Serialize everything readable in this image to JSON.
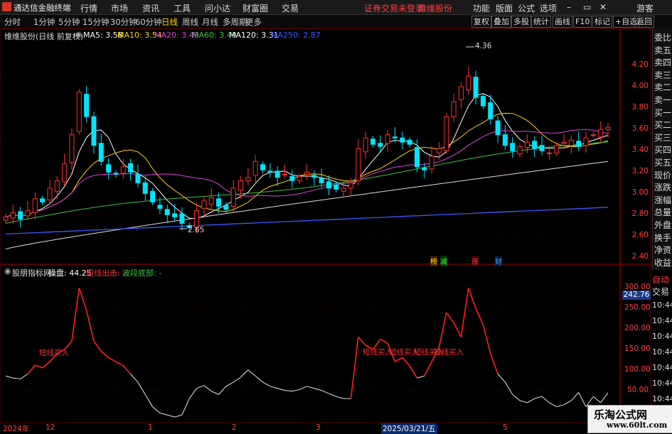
{
  "menubar": {
    "app_title": "通达信金融终端",
    "menu": [
      "行情",
      "市场",
      "资讯",
      "工具",
      "问小达",
      "财富圈",
      "交易"
    ],
    "notice": "证券交易未登录",
    "stock_name": "维维股份",
    "right_menu": [
      "功能",
      "版面",
      "公式",
      "选项"
    ],
    "window_buttons": [
      "–",
      "▭",
      "✕"
    ],
    "user": "游客"
  },
  "toolbar": {
    "periods": [
      "分时",
      "1分钟",
      "5分钟",
      "15分钟",
      "30分钟",
      "60分钟",
      "日线",
      "周线",
      "月线",
      "多周期",
      "更多"
    ],
    "active_period": "日线",
    "right_buttons": [
      "复权",
      "叠加",
      "多股",
      "统计",
      "画线",
      "F10",
      "标记",
      "+自选",
      "返回"
    ]
  },
  "main_chart": {
    "header_title": "维维股份(日线 前复权)",
    "ma": [
      {
        "label": "MA5: 3.58",
        "color": "#ffffff"
      },
      {
        "label": "MA10: 3.54",
        "color": "#ffd400"
      },
      {
        "label": "MA20: 3.49",
        "color": "#e040e0"
      },
      {
        "label": "MA60: 3.49",
        "color": "#40c040"
      },
      {
        "label": "MA120: 3.31",
        "color": "#ffffff"
      },
      {
        "label": "MA250: 2.87",
        "color": "#3a5aff"
      }
    ],
    "high_label": "4.36",
    "low_label": "2.65",
    "event_tags": [
      "榜",
      "减",
      "涨",
      "财"
    ]
  },
  "sub_chart": {
    "title": "股朋指标网",
    "value_label": "操盘: 44.25",
    "signal_red": "短线出击: -",
    "signal_green": "波段底部: -",
    "buy_labels": [
      "短线买入",
      "短线买入",
      "短线买入",
      "短线买入",
      "短线买入"
    ],
    "current_value": "242.76"
  },
  "side_panel": {
    "items": [
      "委比",
      "卖五",
      "卖四",
      "卖三",
      "卖二",
      "卖一",
      "买一",
      "买二",
      "买三",
      "买四",
      "买五",
      "现价",
      "涨跌",
      "涨幅",
      "总量",
      "外盘",
      "换手",
      "净资",
      "收益"
    ],
    "auto": "自动",
    "trade": "交易",
    "times": [
      "10:44",
      "10:44",
      "10:44",
      "10:44",
      "10:44",
      "10:44",
      "10:44",
      "10:45"
    ]
  },
  "dates": {
    "year": "2024年",
    "month_12": "12",
    "month_1": "1",
    "month_2": "2",
    "month_3": "3",
    "cursor_date": "2025/03/21/五",
    "month_5": "5"
  },
  "watermark": {
    "line1": "乐淘公式网",
    "line2": "www.60lt.com"
  },
  "colors": {
    "up": "#ff3030",
    "down": "#00e5ff",
    "grid": "#5a0000",
    "accent": "#ffd400"
  },
  "chart_data": {
    "type": "line",
    "title": "维维股份(日线 前复权)",
    "y_axis_price": {
      "ticks": [
        2.4,
        2.6,
        2.8,
        3.0,
        3.2,
        3.4,
        3.6,
        3.8,
        4.0,
        4.2
      ],
      "range": [
        2.35,
        4.48
      ]
    },
    "y_axis_indicator": {
      "ticks": [
        0.0,
        50.0,
        100.0,
        150.0,
        200.0,
        250.0,
        300.0
      ],
      "range": [
        -20,
        330
      ]
    },
    "candles_close": [
      2.78,
      2.82,
      2.76,
      2.84,
      2.95,
      2.92,
      3.05,
      3.12,
      3.28,
      3.55,
      3.95,
      3.72,
      3.45,
      3.3,
      3.2,
      3.18,
      3.25,
      3.2,
      3.1,
      3.0,
      2.92,
      2.86,
      2.8,
      2.78,
      2.72,
      2.68,
      2.84,
      2.93,
      2.96,
      2.88,
      2.85,
      3.05,
      3.12,
      3.15,
      3.3,
      3.22,
      3.2,
      3.15,
      3.18,
      3.12,
      3.16,
      3.2,
      3.15,
      3.1,
      3.05,
      3.04,
      3.05,
      3.1,
      3.42,
      3.52,
      3.46,
      3.44,
      3.55,
      3.52,
      3.48,
      3.46,
      3.25,
      3.22,
      3.35,
      3.42,
      3.72,
      3.86,
      4.0,
      4.1,
      3.9,
      3.82,
      3.7,
      3.55,
      3.45,
      3.4,
      3.44,
      3.48,
      3.42,
      3.4,
      3.38,
      3.45,
      3.48,
      3.5,
      3.44,
      3.52,
      3.55,
      3.6,
      3.62
    ],
    "indicator": [
      85,
      80,
      78,
      90,
      112,
      105,
      120,
      140,
      150,
      170,
      300,
      245,
      170,
      145,
      130,
      120,
      110,
      90,
      70,
      40,
      10,
      -5,
      -10,
      -15,
      -10,
      30,
      55,
      62,
      48,
      40,
      60,
      70,
      82,
      100,
      85,
      70,
      60,
      55,
      50,
      48,
      52,
      60,
      55,
      50,
      42,
      35,
      30,
      30,
      180,
      160,
      150,
      175,
      165,
      120,
      130,
      110,
      80,
      85,
      120,
      155,
      240,
      215,
      180,
      300,
      250,
      210,
      140,
      90,
      70,
      40,
      25,
      20,
      30,
      35,
      20,
      10,
      15,
      25,
      45,
      10,
      35,
      20,
      44
    ]
  }
}
